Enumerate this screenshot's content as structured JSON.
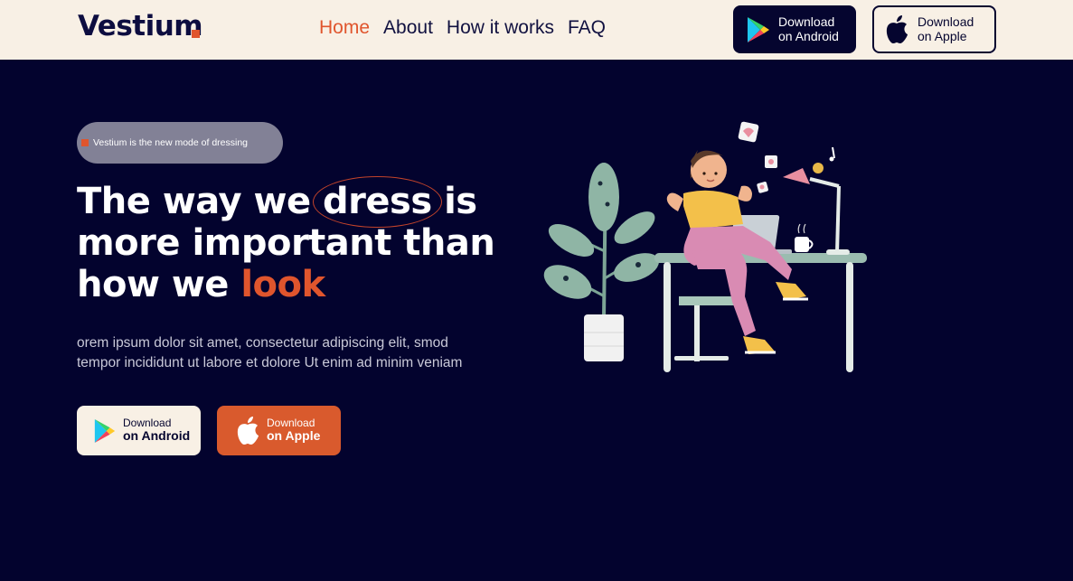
{
  "header": {
    "logo": "Vestium",
    "nav": [
      "Home",
      "About",
      "How it works",
      "FAQ"
    ],
    "active_nav": "Home",
    "android_button": {
      "line1": "Download",
      "line2": "on Android"
    },
    "apple_button": {
      "line1": "Download",
      "line2": "on Apple"
    }
  },
  "hero": {
    "pill_text": "Vestium is the new mode of dressing",
    "headline": {
      "line1_pre": "The way we ",
      "line1_circled": "dress",
      "line1_post": " is",
      "line2": "more important than",
      "line3_pre": "how we ",
      "line3_accent": "look"
    },
    "description": {
      "line1": "orem ipsum dolor sit amet, consectetur adipiscing elit, smod",
      "line2": "tempor incididunt ut labore et dolore Ut enim ad minim veniam"
    },
    "android_button": {
      "line1": "Download",
      "line2": "on Android"
    },
    "apple_button": {
      "line1": "Download",
      "line2": "on Apple"
    }
  },
  "icons": {
    "play_store": "google-play-icon",
    "apple": "apple-icon"
  },
  "colors": {
    "background": "#03032e",
    "header_bg": "#f8f0e5",
    "accent": "#e0552d",
    "navy": "#05052f"
  }
}
